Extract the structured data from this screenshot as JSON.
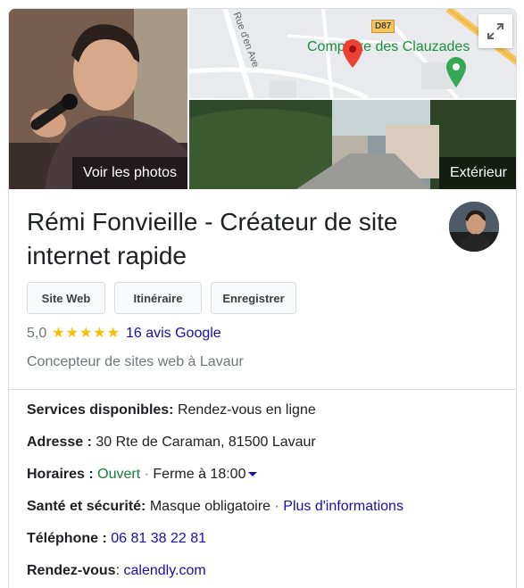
{
  "photos": {
    "main_label": "Voir les photos",
    "street_label": "Extérieur"
  },
  "map": {
    "road_label": "D87",
    "place_name": "Complexe des Clauzades",
    "street_name": "Rue d'en Ave"
  },
  "business": {
    "name": "Rémi Fonvieille - Créateur de site internet rapide",
    "category": "Concepteur de sites web à Lavaur"
  },
  "actions": {
    "website": "Site Web",
    "directions": "Itinéraire",
    "save": "Enregistrer"
  },
  "rating": {
    "value": "5,0",
    "stars": 5,
    "stars_text": "★★★★★",
    "reviews": "16 avis Google"
  },
  "info": {
    "services_label": "Services disponibles:",
    "services_value": "Rendez-vous en ligne",
    "address_label": "Adresse :",
    "address_value": "30 Rte de Caraman, 81500 Lavaur",
    "hours_label": "Horaires :",
    "hours_status": "Ouvert",
    "hours_sep": "·",
    "hours_close": "Ferme à 18:00",
    "safety_label": "Santé et sécurité:",
    "safety_value": "Masque obligatoire",
    "safety_sep": "·",
    "safety_link": "Plus d'informations",
    "phone_label": "Téléphone :",
    "phone_value": "06 81 38 22 81",
    "appointment_label": "Rendez-vous",
    "appointment_colon": ":",
    "appointment_link": "calendly.com"
  },
  "colors": {
    "link": "#1a0dab",
    "open": "#188038",
    "star": "#fbbc04",
    "map_pin": "#ea4335",
    "place_pin": "#34a853"
  }
}
